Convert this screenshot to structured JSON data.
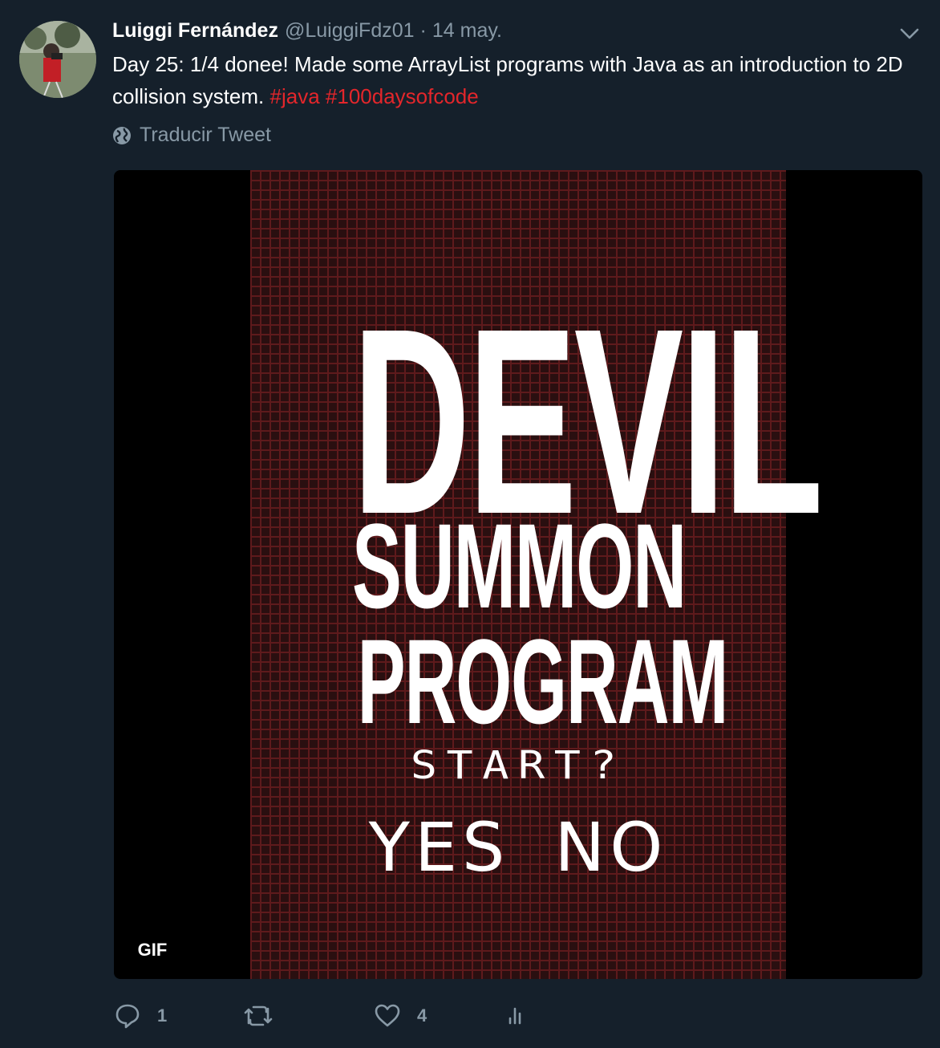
{
  "tweet": {
    "author_name": "Luiggi Fernández",
    "handle": "@LuiggiFdz01",
    "separator": "·",
    "date": "14 may.",
    "text_prefix": "Day 25: 1/4 donee! Made some ArrayList programs with Java as an introduction to 2D collision system.",
    "hashtags": [
      "#java",
      "#100daysofcode"
    ],
    "translate_label": "Traducir Tweet"
  },
  "media": {
    "type_badge": "GIF",
    "lines": [
      "DEVIL",
      "SUMMON",
      "PROGRAM"
    ],
    "prompt": "START?",
    "options": [
      "YES",
      "NO"
    ]
  },
  "actions": {
    "reply_count": "1",
    "retweet_count": "",
    "like_count": "4"
  },
  "colors": {
    "background": "#15202b",
    "secondary_text": "#8899a6",
    "hashtag": "#e3262b"
  },
  "icons": [
    "caret-down-icon",
    "globe-icon",
    "reply-icon",
    "retweet-icon",
    "like-icon",
    "analytics-icon"
  ]
}
